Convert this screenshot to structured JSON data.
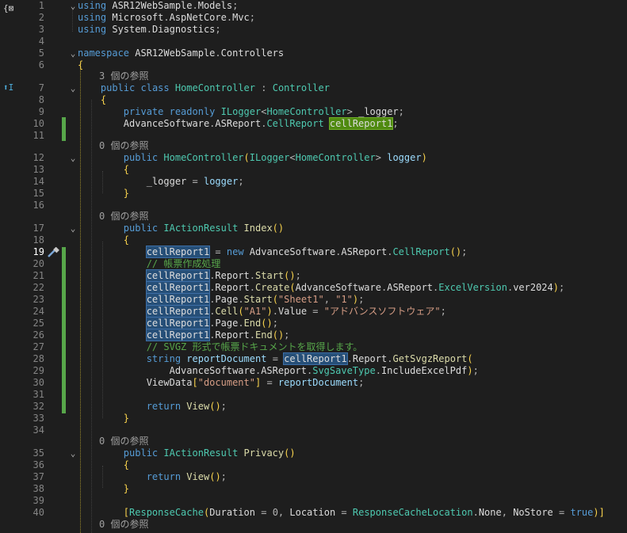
{
  "editor": {
    "language": "C#",
    "current_line": 19
  },
  "gutter": {
    "top_icon": "namespace-scope-icon",
    "top_icon_glyph": "{⊠",
    "inherit_icon": "inherit-icon",
    "inherit_icon_glyph": "⬆I",
    "quick_action_icon": "screwdriver-icon"
  },
  "code_lens": {
    "refs_3": "3 個の参照",
    "refs_0": "0 個の参照"
  },
  "lines": [
    {
      "n": "1",
      "t": "using ASR12WebSample.Models;"
    },
    {
      "n": "2",
      "t": "using Microsoft.AspNetCore.Mvc;"
    },
    {
      "n": "3",
      "t": "using System.Diagnostics;"
    },
    {
      "n": "4",
      "t": ""
    },
    {
      "n": "5",
      "t": "namespace ASR12WebSample.Controllers"
    },
    {
      "n": "6",
      "t": "{"
    },
    {
      "n": "7",
      "t": "    public class HomeController : Controller"
    },
    {
      "n": "8",
      "t": "    {"
    },
    {
      "n": "9",
      "t": "        private readonly ILogger<HomeController> _logger;"
    },
    {
      "n": "10",
      "t": "        AdvanceSoftware.ASReport.CellReport cellReport1;"
    },
    {
      "n": "11",
      "t": ""
    },
    {
      "n": "12",
      "t": "        public HomeController(ILogger<HomeController> logger)"
    },
    {
      "n": "13",
      "t": "        {"
    },
    {
      "n": "14",
      "t": "            _logger = logger;"
    },
    {
      "n": "15",
      "t": "        }"
    },
    {
      "n": "16",
      "t": ""
    },
    {
      "n": "17",
      "t": "        public IActionResult Index()"
    },
    {
      "n": "18",
      "t": "        {"
    },
    {
      "n": "19",
      "t": "            cellReport1 = new AdvanceSoftware.ASReport.CellReport();"
    },
    {
      "n": "20",
      "t": "            // 帳票作成処理"
    },
    {
      "n": "21",
      "t": "            cellReport1.Report.Start();"
    },
    {
      "n": "22",
      "t": "            cellReport1.Report.Create(AdvanceSoftware.ASReport.ExcelVersion.ver2024);"
    },
    {
      "n": "23",
      "t": "            cellReport1.Page.Start(\"Sheet1\", \"1\");"
    },
    {
      "n": "24",
      "t": "            cellReport1.Cell(\"A1\").Value = \"アドバンスソフトウェア\";"
    },
    {
      "n": "25",
      "t": "            cellReport1.Page.End();"
    },
    {
      "n": "26",
      "t": "            cellReport1.Report.End();"
    },
    {
      "n": "27",
      "t": "            // SVGZ 形式で帳票ドキュメントを取得します。"
    },
    {
      "n": "28",
      "t": "            string reportDocument = cellReport1.Report.GetSvgzReport("
    },
    {
      "n": "29",
      "t": "                AdvanceSoftware.ASReport.SvgSaveType.IncludeExcelPdf);"
    },
    {
      "n": "30",
      "t": "            ViewData[\"document\"] = reportDocument;"
    },
    {
      "n": "31",
      "t": ""
    },
    {
      "n": "32",
      "t": "            return View();"
    },
    {
      "n": "33",
      "t": "        }"
    },
    {
      "n": "34",
      "t": ""
    },
    {
      "n": "35",
      "t": "        public IActionResult Privacy()"
    },
    {
      "n": "36",
      "t": "        {"
    },
    {
      "n": "37",
      "t": "            return View();"
    },
    {
      "n": "38",
      "t": "        }"
    },
    {
      "n": "39",
      "t": ""
    },
    {
      "n": "40",
      "t": "        [ResponseCache(Duration = 0, Location = ResponseCacheLocation.None, NoStore = true)]"
    }
  ],
  "colors": {
    "background": "#1e1e1e",
    "keyword": "#569cd6",
    "type": "#4ec9b0",
    "method": "#dcdcaa",
    "string": "#d69d85",
    "comment": "#57a64a",
    "change_bar": "#57a64a",
    "highlight": "#264f78",
    "highlight_green": "#4f8a10"
  }
}
